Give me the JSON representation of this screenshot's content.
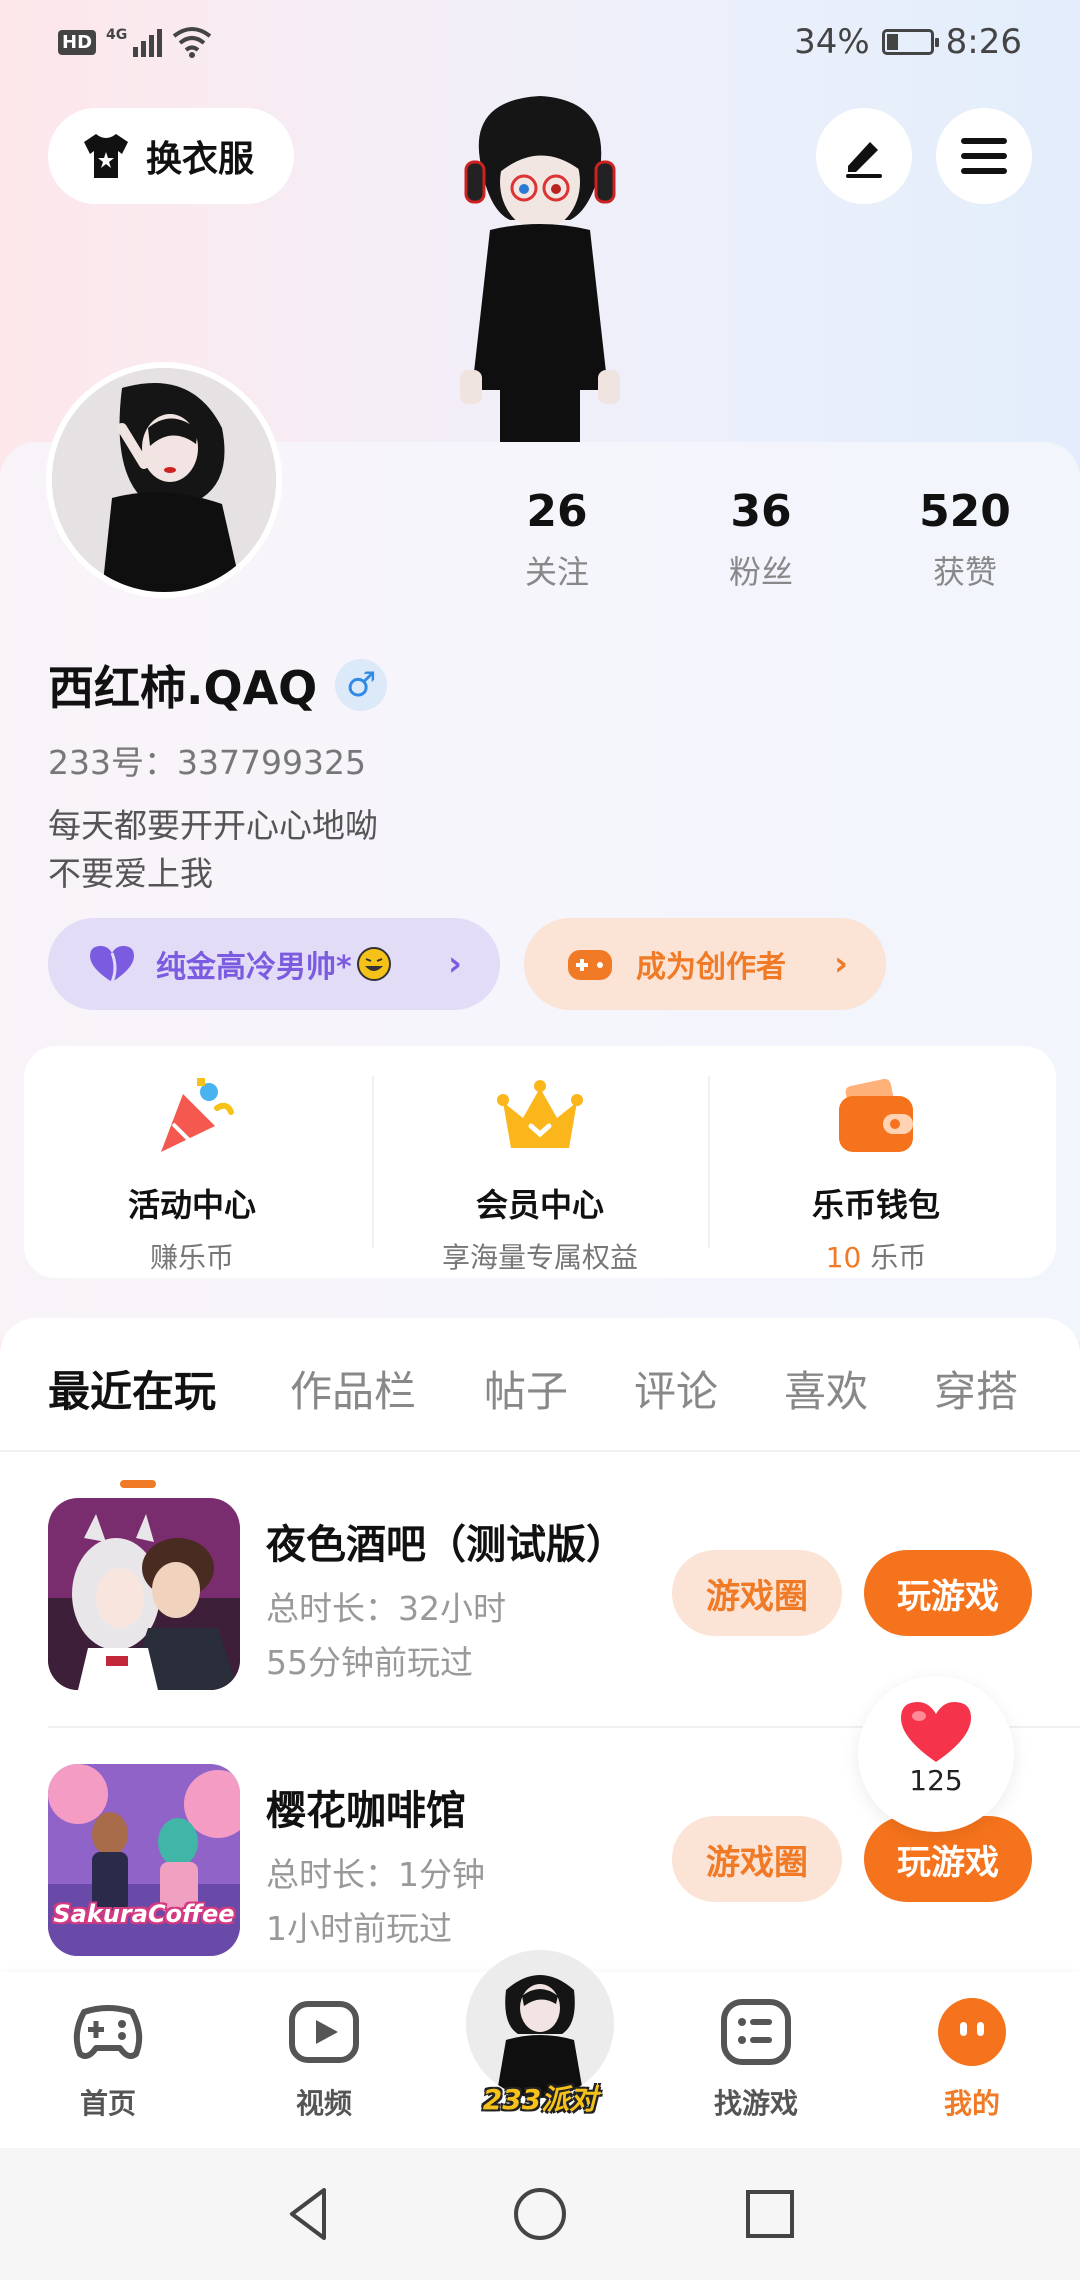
{
  "status_bar": {
    "hd": "HD",
    "network": "4G",
    "battery_percent": "34%",
    "battery_level": 0.34,
    "time": "8:26"
  },
  "header": {
    "outfit_label": "换衣服"
  },
  "profile": {
    "stats": [
      {
        "value": "26",
        "label": "关注"
      },
      {
        "value": "36",
        "label": "粉丝"
      },
      {
        "value": "520",
        "label": "获赞"
      }
    ],
    "username": "西红柿.QAQ",
    "gender_symbol": "♂",
    "user_id": "233号：337799325",
    "bio_line1": "每天都要开开心心地呦",
    "bio_line2": "不要爱上我",
    "vip_title": "纯金高冷男帅*",
    "creator_label": "成为创作者"
  },
  "services": [
    {
      "title": "活动中心",
      "sub": "赚乐币"
    },
    {
      "title": "会员中心",
      "sub": "享海量专属权益"
    },
    {
      "title": "乐币钱包",
      "sub_value": "10",
      "sub_unit": " 乐币"
    }
  ],
  "tabs": [
    "最近在玩",
    "作品栏",
    "帖子",
    "评论",
    "喜欢",
    "穿搭"
  ],
  "games": [
    {
      "name": "夜色酒吧（测试版）",
      "duration": "总时长：32小时",
      "last_played": "55分钟前玩过",
      "circle_label": "游戏圈",
      "play_label": "玩游戏"
    },
    {
      "name": "樱花咖啡馆",
      "duration": "总时长：1分钟",
      "last_played": "1小时前玩过",
      "circle_label": "游戏圈",
      "play_label": "玩游戏",
      "thumb_text": "SakuraCoffee"
    }
  ],
  "like_count": "125",
  "bottom_nav": {
    "home": "首页",
    "video": "视频",
    "party": "233派对",
    "find_games": "找游戏",
    "mine": "我的"
  },
  "colors": {
    "accent": "#f5731c",
    "vip_purple": "#7b5ce0",
    "gender_blue": "#2f8be6"
  }
}
